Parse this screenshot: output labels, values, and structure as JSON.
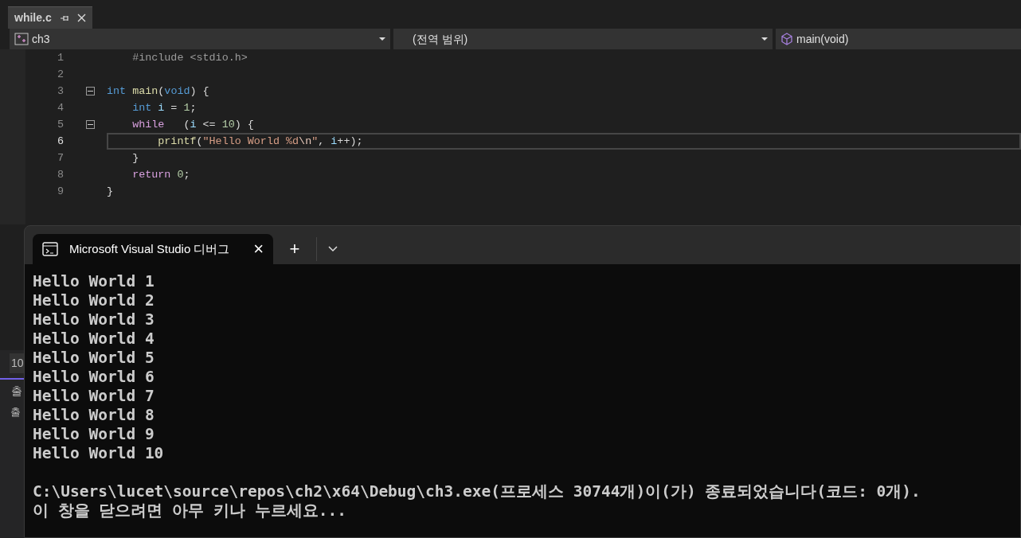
{
  "editor_tabs": [
    {
      "label": "while.c",
      "selected": true
    }
  ],
  "navigation_bar": {
    "project": "ch3",
    "scope": "(전역 범위)",
    "member": "main(void)"
  },
  "code_lines": [
    {
      "number": "1",
      "current": false,
      "fold": false,
      "tokens": [
        {
          "text": "    #include <stdio.h>",
          "kind": "preproc"
        }
      ]
    },
    {
      "number": "2",
      "current": false,
      "fold": false
    },
    {
      "number": "3",
      "current": false,
      "fold": true,
      "tokens": [
        {
          "text": "int",
          "kind": "keyword"
        },
        {
          "text": " main",
          "kind": "function"
        },
        {
          "text": "(",
          "kind": "plain"
        },
        {
          "text": "void",
          "kind": "keyword"
        },
        {
          "text": ") {",
          "kind": "plain"
        }
      ]
    },
    {
      "number": "4",
      "current": false,
      "fold": false,
      "tokens": [
        {
          "text": "    int",
          "kind": "keyword"
        },
        {
          "text": " i",
          "kind": "variable"
        },
        {
          "text": " = ",
          "kind": "plain"
        },
        {
          "text": "1",
          "kind": "number"
        },
        {
          "text": ";",
          "kind": "plain"
        }
      ]
    },
    {
      "number": "5",
      "current": false,
      "fold": true,
      "tokens": [
        {
          "text": "    while",
          "kind": "control"
        },
        {
          "text": "   (",
          "kind": "plain"
        },
        {
          "text": "i",
          "kind": "variable"
        },
        {
          "text": " <= ",
          "kind": "plain"
        },
        {
          "text": "10",
          "kind": "number"
        },
        {
          "text": ") {",
          "kind": "plain"
        }
      ]
    },
    {
      "number": "6",
      "current": true,
      "fold": false,
      "tokens": [
        {
          "text": "        printf",
          "kind": "function"
        },
        {
          "text": "(",
          "kind": "plain"
        },
        {
          "text": "\"Hello World %d",
          "kind": "string"
        },
        {
          "text": "\\n",
          "kind": "escape"
        },
        {
          "text": "\"",
          "kind": "string"
        },
        {
          "text": ", ",
          "kind": "plain"
        },
        {
          "text": "i",
          "kind": "variable"
        },
        {
          "text": "++);",
          "kind": "plain"
        }
      ]
    },
    {
      "number": "7",
      "current": false,
      "fold": false,
      "tokens": [
        {
          "text": "    }",
          "kind": "plain"
        }
      ]
    },
    {
      "number": "8",
      "current": false,
      "fold": false,
      "tokens": [
        {
          "text": "    return",
          "kind": "control"
        },
        {
          "text": " 0",
          "kind": "number"
        },
        {
          "text": ";",
          "kind": "plain"
        }
      ]
    },
    {
      "number": "9",
      "current": false,
      "fold": false,
      "tokens": [
        {
          "text": "}",
          "kind": "plain"
        }
      ]
    }
  ],
  "background_panel": {
    "line_field": "10",
    "tab": "출",
    "label": "출"
  },
  "console": {
    "tab": {
      "title": "Microsoft Visual Studio 디버그",
      "close": "×"
    },
    "new_tab": "+",
    "output": [
      "Hello World 1",
      "Hello World 2",
      "Hello World 3",
      "Hello World 4",
      "Hello World 5",
      "Hello World 6",
      "Hello World 7",
      "Hello World 8",
      "Hello World 9",
      "Hello World 10"
    ],
    "exit_message": [
      "C:\\Users\\lucet\\source\\repos\\ch2\\x64\\Debug\\ch3.exe(프로세스 30744개)이(가) 종료되었습니다(코드: 0개).",
      "이 창을 닫으려면 아무 키나 누르세요..."
    ]
  }
}
